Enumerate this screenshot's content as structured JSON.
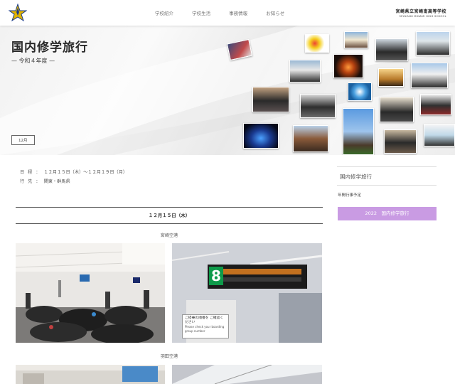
{
  "header": {
    "nav": [
      "学校紹介",
      "学校生活",
      "事務情報",
      "お知らせ"
    ],
    "school_name_jp": "宮崎県立宮崎南高等学校",
    "school_name_en": "MIYAZAKI MINAMI HIGH SCHOOL"
  },
  "hero": {
    "title": "国内修学旅行",
    "subtitle": "— 令和４年度 —",
    "month_tag": "12月"
  },
  "info": {
    "schedule_label": "日程：",
    "schedule_value": "１２月１５日（木）～１２月１９日（月）",
    "destination_label": "行先：",
    "destination_value": "関東・群馬県"
  },
  "main": {
    "date_heading": "１２月１５日（木）",
    "sections": [
      "宮崎空港",
      "羽田空港"
    ]
  },
  "gate_sign": {
    "number": "8",
    "label_jp": "ご搭乗の順番を ご確認ください",
    "label_en": "Please check your boarding group number"
  },
  "sidebar": {
    "title": "国内修学旅行",
    "link": "年間行事予定",
    "button": "2022　国内修学旅行"
  },
  "colors": {
    "accent": "#c99be3",
    "divider": "#555555"
  }
}
